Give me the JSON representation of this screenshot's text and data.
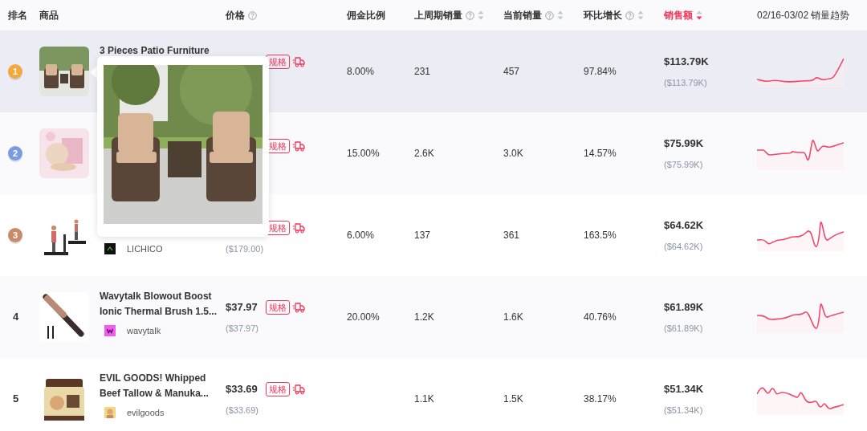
{
  "columns": [
    {
      "label": "排名"
    },
    {
      "label": "商品"
    },
    {
      "label": "价格",
      "help": true
    },
    {
      "label": "佣金比例"
    },
    {
      "label": "上周期销量",
      "help": true,
      "sortable": true,
      "sorted": false
    },
    {
      "label": "当前销量",
      "help": true,
      "sortable": true,
      "sorted": false
    },
    {
      "label": "环比增长",
      "help": true,
      "sortable": true,
      "sorted": false
    },
    {
      "label": "销售额",
      "sortable": true,
      "sorted": true
    },
    {
      "label": "02/16-03/02 销量趋势"
    }
  ],
  "rows": [
    {
      "highlighted": true,
      "rank": "1",
      "kind": "medal",
      "color": "#f2a93b",
      "title": "3 Pieces Patio Furniture",
      "spec_tag": "规格",
      "commission": "8.00%",
      "last_period": "231",
      "current": "457",
      "growth": "97.84%",
      "sales": "$113.79K",
      "sales_sub": "($113.79K)"
    },
    {
      "highlighted": false,
      "rank": "2",
      "kind": "medal",
      "color": "#7b9be0",
      "spec_tag": "规格",
      "commission": "15.00%",
      "last_period": "2.6K",
      "current": "3.0K",
      "growth": "14.57%",
      "sales": "$75.99K",
      "sales_sub": "($75.99K)"
    },
    {
      "highlighted": false,
      "rank": "3",
      "kind": "medal",
      "color": "#c98a6a",
      "shop": "LICHICO",
      "price_sub": "($179.00)",
      "spec_tag": "规格",
      "commission": "6.00%",
      "last_period": "137",
      "current": "361",
      "growth": "163.5%",
      "sales": "$64.62K",
      "sales_sub": "($64.62K)"
    },
    {
      "highlighted": false,
      "rank": "4",
      "kind": "plain",
      "title": "Wavytalk Blowout Boost Ionic Thermal Brush 1.5...",
      "shop": "wavytalk",
      "price": "$37.97",
      "price_sub": "($37.97)",
      "spec_tag": "规格",
      "commission": "20.00%",
      "last_period": "1.2K",
      "current": "1.6K",
      "growth": "40.76%",
      "sales": "$61.89K",
      "sales_sub": "($61.89K)"
    },
    {
      "highlighted": false,
      "rank": "5",
      "kind": "plain",
      "title": "EVIL GOODS! Whipped Beef Tallow & Manuka...",
      "shop": "evilgoods",
      "price": "$33.69",
      "price_sub": "($33.69)",
      "spec_tag": "规格",
      "last_period": "1.1K",
      "current": "1.5K",
      "growth": "38.17%",
      "sales": "$51.34K",
      "sales_sub": "($51.34K)"
    }
  ]
}
